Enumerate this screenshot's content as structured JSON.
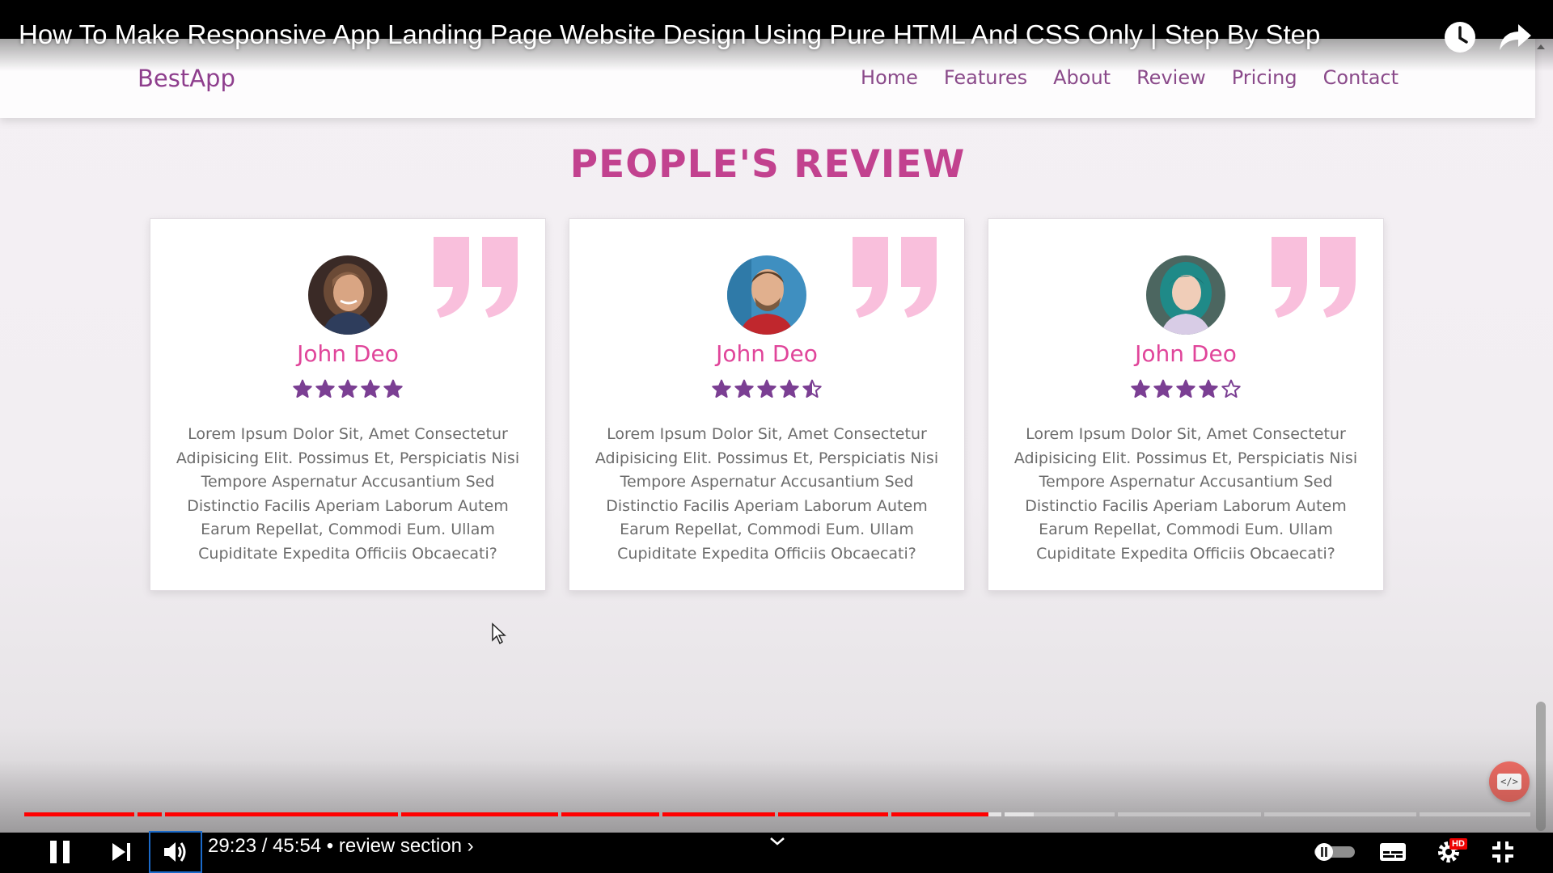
{
  "player": {
    "video_title": "How To Make Responsive App Landing Page Website Design Using Pure HTML And CSS Only | Step By Step",
    "current_time": "29:23",
    "duration": "45:54",
    "time_separator": " / ",
    "chapter_separator": " • ",
    "chapter_title": "review section ›",
    "progress_fraction": 0.64,
    "hd_badge": "HD",
    "accent_color": "#ff0000"
  },
  "site": {
    "logo": "BestApp",
    "nav": [
      "Home",
      "Features",
      "About",
      "Review",
      "Pricing",
      "Contact"
    ],
    "review_heading": "PEOPLE'S REVIEW",
    "code_badge": "</>"
  },
  "reviews": [
    {
      "name": "John Deo",
      "rating": 5,
      "text": "Lorem Ipsum Dolor Sit, Amet Consectetur Adipisicing Elit. Possimus Et, Perspiciatis Nisi Tempore Aspernatur Accusantium Sed Distinctio Facilis Aperiam Laborum Autem Earum Repellat, Commodi Eum. Ullam Cupiditate Expedita Officiis Obcaecati?"
    },
    {
      "name": "John Deo",
      "rating": 4.5,
      "text": "Lorem Ipsum Dolor Sit, Amet Consectetur Adipisicing Elit. Possimus Et, Perspiciatis Nisi Tempore Aspernatur Accusantium Sed Distinctio Facilis Aperiam Laborum Autem Earum Repellat, Commodi Eum. Ullam Cupiditate Expedita Officiis Obcaecati?"
    },
    {
      "name": "John Deo",
      "rating": 4,
      "text": "Lorem Ipsum Dolor Sit, Amet Consectetur Adipisicing Elit. Possimus Et, Perspiciatis Nisi Tempore Aspernatur Accusantium Sed Distinctio Facilis Aperiam Laborum Autem Earum Repellat, Commodi Eum. Ullam Cupiditate Expedita Officiis Obcaecati?"
    }
  ],
  "colors": {
    "brand": "#8e3e8d",
    "heading": "#c2428f",
    "name": "#e0459a",
    "star": "#7b3f93",
    "quote": "#f9bfdc"
  }
}
